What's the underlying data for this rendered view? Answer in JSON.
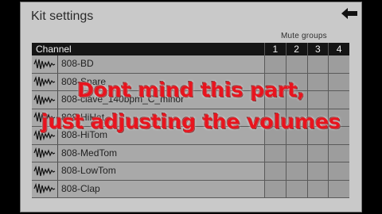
{
  "header": {
    "title": "Kit settings",
    "back_icon": "back-arrow-icon"
  },
  "table": {
    "mute_groups_label": "Mute groups",
    "channel_header": "Channel",
    "group_columns": [
      "1",
      "2",
      "3",
      "4"
    ],
    "rows": [
      {
        "name": "808-BD",
        "icon": "waveform-icon"
      },
      {
        "name": "808-Snare",
        "icon": "waveform-icon"
      },
      {
        "name": "808-clave_140bpm_C_minor",
        "icon": "waveform-icon"
      },
      {
        "name": "808-HiHat",
        "icon": "waveform-icon"
      },
      {
        "name": "808-HiTom",
        "icon": "waveform-icon"
      },
      {
        "name": "808-MedTom",
        "icon": "waveform-icon"
      },
      {
        "name": "808-LowTom",
        "icon": "waveform-icon"
      },
      {
        "name": "808-Clap",
        "icon": "waveform-icon"
      }
    ]
  },
  "overlay_caption": {
    "line1": "Dont mind this part,",
    "line2": "just adjusting the volumes",
    "color": "#e8141e"
  }
}
